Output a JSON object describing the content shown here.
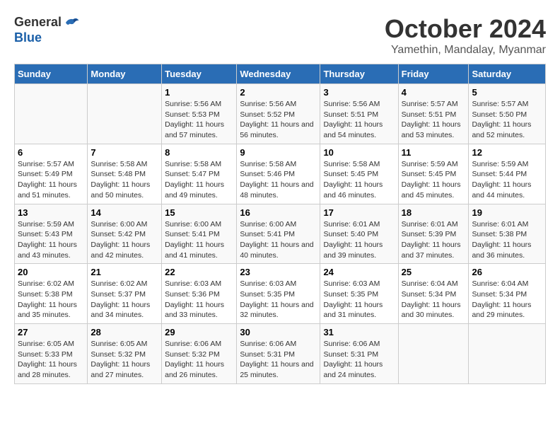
{
  "logo": {
    "general": "General",
    "blue": "Blue"
  },
  "header": {
    "title": "October 2024",
    "subtitle": "Yamethin, Mandalay, Myanmar"
  },
  "days_of_week": [
    "Sunday",
    "Monday",
    "Tuesday",
    "Wednesday",
    "Thursday",
    "Friday",
    "Saturday"
  ],
  "weeks": [
    [
      {
        "day": "",
        "info": ""
      },
      {
        "day": "",
        "info": ""
      },
      {
        "day": "1",
        "info": "Sunrise: 5:56 AM\nSunset: 5:53 PM\nDaylight: 11 hours and 57 minutes."
      },
      {
        "day": "2",
        "info": "Sunrise: 5:56 AM\nSunset: 5:52 PM\nDaylight: 11 hours and 56 minutes."
      },
      {
        "day": "3",
        "info": "Sunrise: 5:56 AM\nSunset: 5:51 PM\nDaylight: 11 hours and 54 minutes."
      },
      {
        "day": "4",
        "info": "Sunrise: 5:57 AM\nSunset: 5:51 PM\nDaylight: 11 hours and 53 minutes."
      },
      {
        "day": "5",
        "info": "Sunrise: 5:57 AM\nSunset: 5:50 PM\nDaylight: 11 hours and 52 minutes."
      }
    ],
    [
      {
        "day": "6",
        "info": "Sunrise: 5:57 AM\nSunset: 5:49 PM\nDaylight: 11 hours and 51 minutes."
      },
      {
        "day": "7",
        "info": "Sunrise: 5:58 AM\nSunset: 5:48 PM\nDaylight: 11 hours and 50 minutes."
      },
      {
        "day": "8",
        "info": "Sunrise: 5:58 AM\nSunset: 5:47 PM\nDaylight: 11 hours and 49 minutes."
      },
      {
        "day": "9",
        "info": "Sunrise: 5:58 AM\nSunset: 5:46 PM\nDaylight: 11 hours and 48 minutes."
      },
      {
        "day": "10",
        "info": "Sunrise: 5:58 AM\nSunset: 5:45 PM\nDaylight: 11 hours and 46 minutes."
      },
      {
        "day": "11",
        "info": "Sunrise: 5:59 AM\nSunset: 5:45 PM\nDaylight: 11 hours and 45 minutes."
      },
      {
        "day": "12",
        "info": "Sunrise: 5:59 AM\nSunset: 5:44 PM\nDaylight: 11 hours and 44 minutes."
      }
    ],
    [
      {
        "day": "13",
        "info": "Sunrise: 5:59 AM\nSunset: 5:43 PM\nDaylight: 11 hours and 43 minutes."
      },
      {
        "day": "14",
        "info": "Sunrise: 6:00 AM\nSunset: 5:42 PM\nDaylight: 11 hours and 42 minutes."
      },
      {
        "day": "15",
        "info": "Sunrise: 6:00 AM\nSunset: 5:41 PM\nDaylight: 11 hours and 41 minutes."
      },
      {
        "day": "16",
        "info": "Sunrise: 6:00 AM\nSunset: 5:41 PM\nDaylight: 11 hours and 40 minutes."
      },
      {
        "day": "17",
        "info": "Sunrise: 6:01 AM\nSunset: 5:40 PM\nDaylight: 11 hours and 39 minutes."
      },
      {
        "day": "18",
        "info": "Sunrise: 6:01 AM\nSunset: 5:39 PM\nDaylight: 11 hours and 37 minutes."
      },
      {
        "day": "19",
        "info": "Sunrise: 6:01 AM\nSunset: 5:38 PM\nDaylight: 11 hours and 36 minutes."
      }
    ],
    [
      {
        "day": "20",
        "info": "Sunrise: 6:02 AM\nSunset: 5:38 PM\nDaylight: 11 hours and 35 minutes."
      },
      {
        "day": "21",
        "info": "Sunrise: 6:02 AM\nSunset: 5:37 PM\nDaylight: 11 hours and 34 minutes."
      },
      {
        "day": "22",
        "info": "Sunrise: 6:03 AM\nSunset: 5:36 PM\nDaylight: 11 hours and 33 minutes."
      },
      {
        "day": "23",
        "info": "Sunrise: 6:03 AM\nSunset: 5:35 PM\nDaylight: 11 hours and 32 minutes."
      },
      {
        "day": "24",
        "info": "Sunrise: 6:03 AM\nSunset: 5:35 PM\nDaylight: 11 hours and 31 minutes."
      },
      {
        "day": "25",
        "info": "Sunrise: 6:04 AM\nSunset: 5:34 PM\nDaylight: 11 hours and 30 minutes."
      },
      {
        "day": "26",
        "info": "Sunrise: 6:04 AM\nSunset: 5:34 PM\nDaylight: 11 hours and 29 minutes."
      }
    ],
    [
      {
        "day": "27",
        "info": "Sunrise: 6:05 AM\nSunset: 5:33 PM\nDaylight: 11 hours and 28 minutes."
      },
      {
        "day": "28",
        "info": "Sunrise: 6:05 AM\nSunset: 5:32 PM\nDaylight: 11 hours and 27 minutes."
      },
      {
        "day": "29",
        "info": "Sunrise: 6:06 AM\nSunset: 5:32 PM\nDaylight: 11 hours and 26 minutes."
      },
      {
        "day": "30",
        "info": "Sunrise: 6:06 AM\nSunset: 5:31 PM\nDaylight: 11 hours and 25 minutes."
      },
      {
        "day": "31",
        "info": "Sunrise: 6:06 AM\nSunset: 5:31 PM\nDaylight: 11 hours and 24 minutes."
      },
      {
        "day": "",
        "info": ""
      },
      {
        "day": "",
        "info": ""
      }
    ]
  ]
}
